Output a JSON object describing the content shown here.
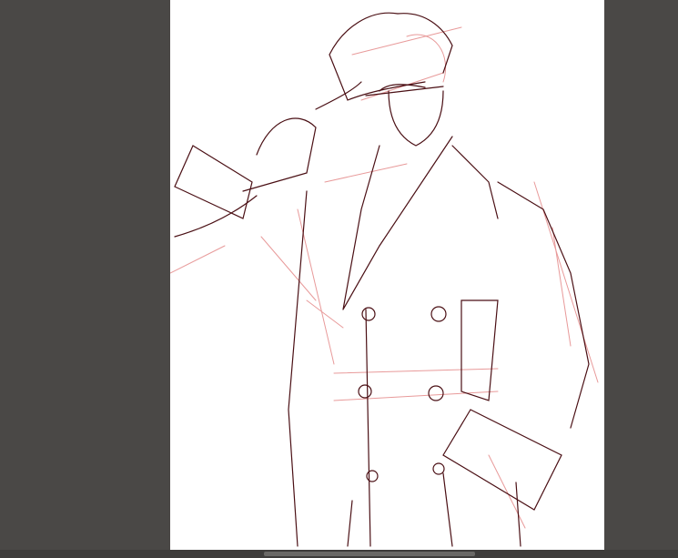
{
  "app": {
    "view": "drawing-canvas"
  },
  "colors": {
    "workspace": "#4a4846",
    "canvas": "#ffffff",
    "ink_dark": "#4a0f14",
    "ink_light": "#e89a9a"
  },
  "scrollbar": {
    "horizontal_position": 0.45
  }
}
